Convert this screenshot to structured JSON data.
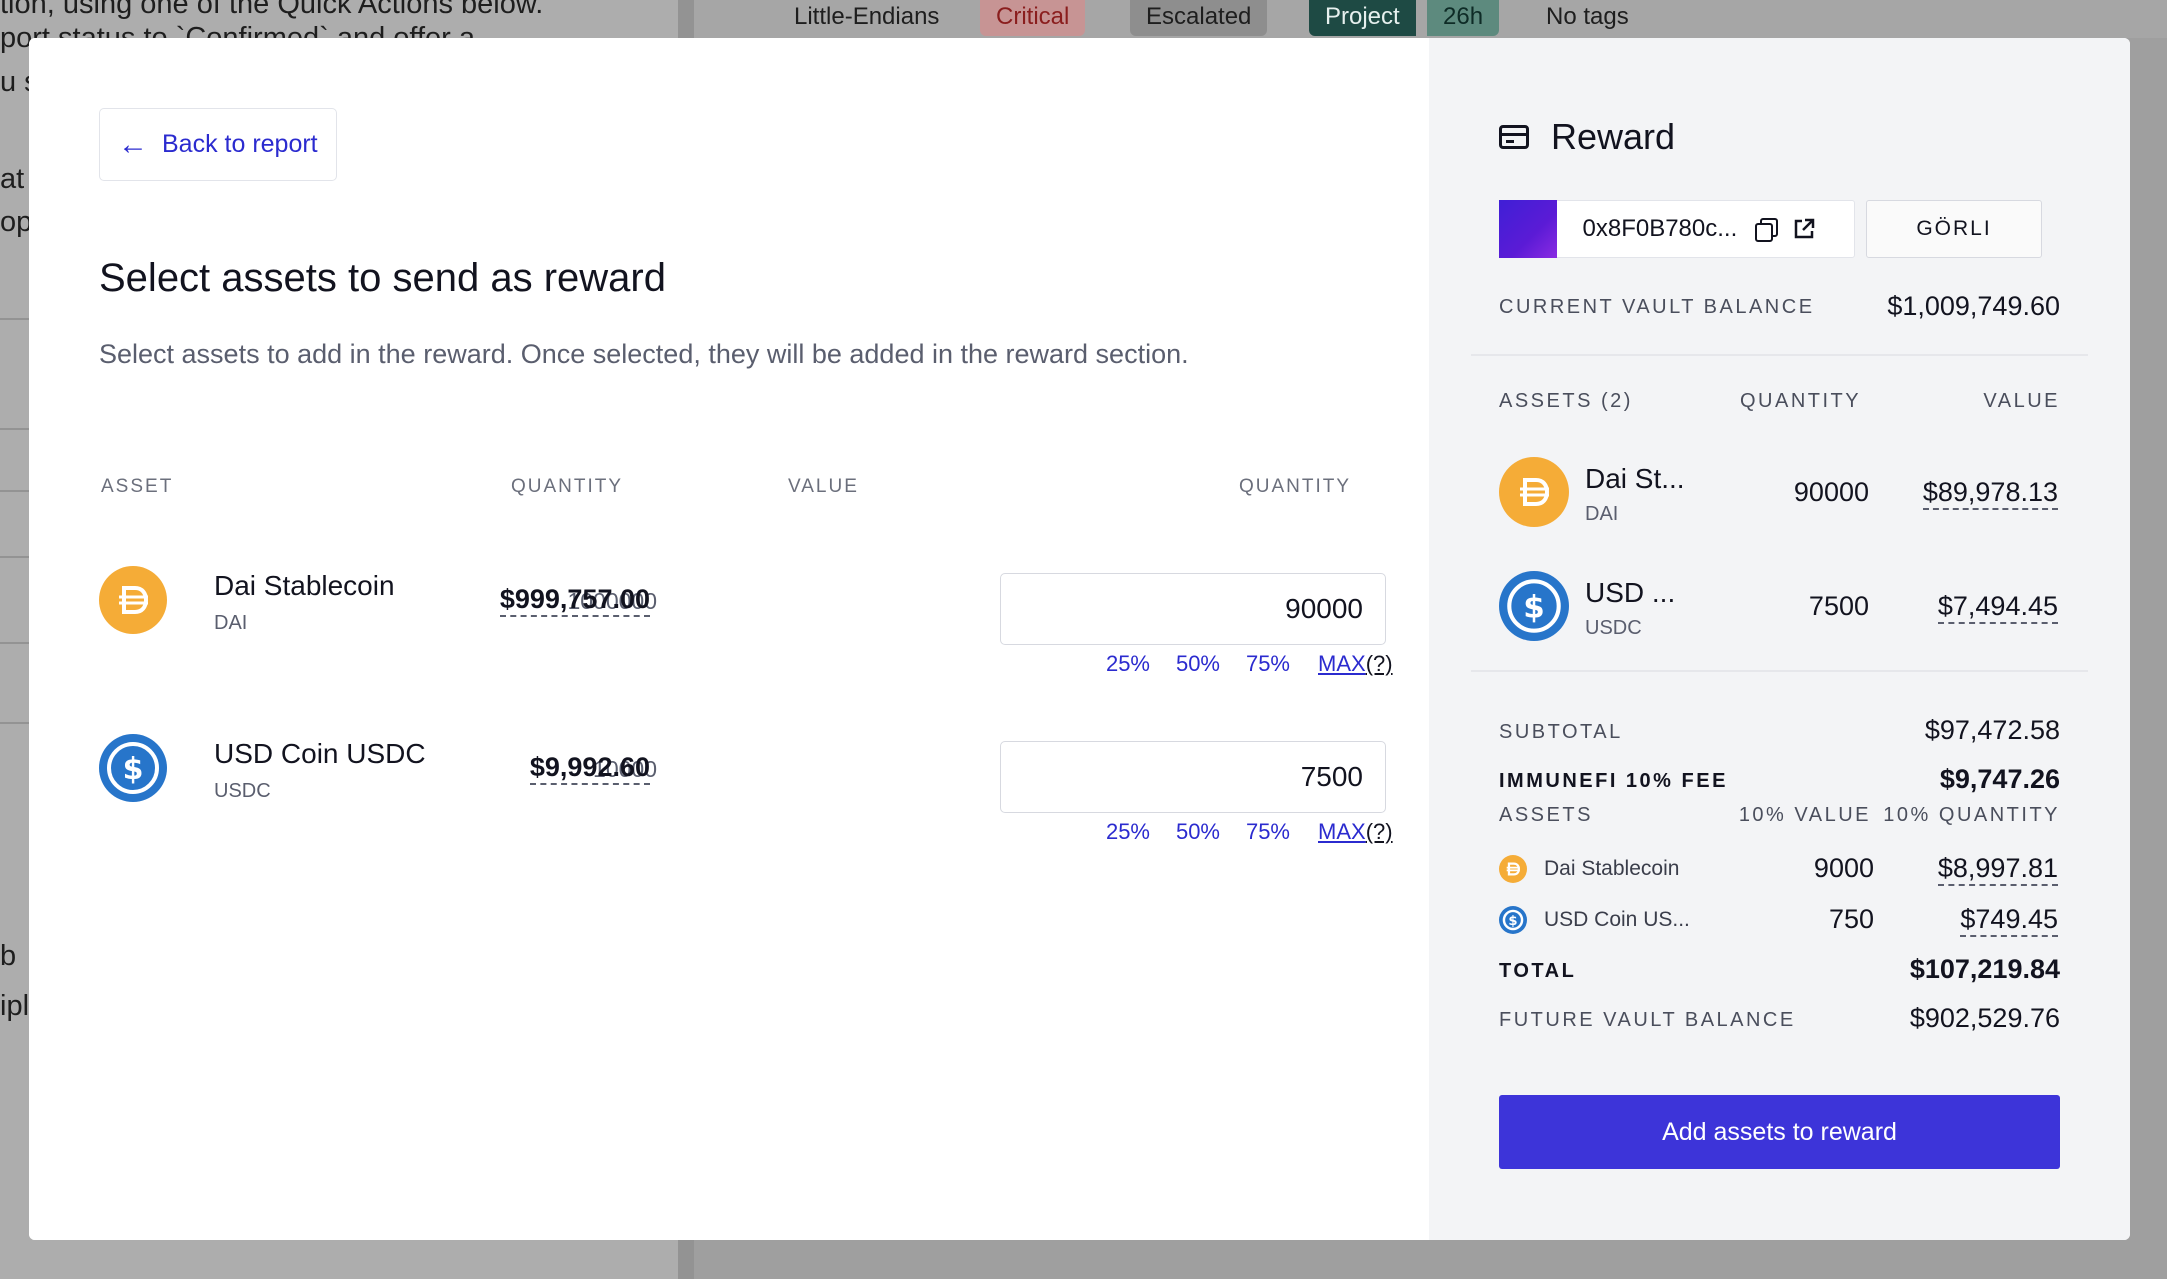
{
  "background": {
    "left_text_lines": [
      "tion, using one of the Quick Actions below.",
      "port status to `Confirmed` and offer a",
      "u s",
      "",
      "at",
      "op",
      "b",
      "ipl"
    ],
    "tags": {
      "project_name": "Little-Endians",
      "severity": "Critical",
      "status": "Escalated",
      "project_label": "Project",
      "age": "26h",
      "tags_text": "No tags"
    }
  },
  "modal": {
    "back_label": "Back to report",
    "title": "Select assets to send as reward",
    "subtitle": "Select assets to add in the reward. Once selected, they will be added in the reward section.",
    "table_headers": {
      "asset": "ASSET",
      "quantity": "QUANTITY",
      "value": "VALUE",
      "input_quantity": "QUANTITY"
    },
    "assets": [
      {
        "name": "Dai Stablecoin",
        "symbol": "DAI",
        "quantity": "1000000",
        "value": "$999,757.00",
        "input_value": "90000",
        "icon": "dai-icon"
      },
      {
        "name": "USD Coin USDC",
        "symbol": "USDC",
        "quantity": "10000",
        "value": "$9,992.60",
        "input_value": "7500",
        "icon": "usdc-icon"
      }
    ],
    "percent_options": [
      "25%",
      "50%",
      "75%"
    ],
    "max_label": "MAX",
    "max_help": "(?)"
  },
  "reward": {
    "heading": "Reward",
    "vault_address": "0x8F0B780c...",
    "network": "GÖRLI",
    "current_vault_balance_label": "CURRENT VAULT BALANCE",
    "current_vault_balance": "$1,009,749.60",
    "assets_header": {
      "assets": "ASSETS (2)",
      "quantity": "QUANTITY",
      "value": "VALUE"
    },
    "assets": [
      {
        "name": "Dai St...",
        "symbol": "DAI",
        "quantity": "90000",
        "value": "$89,978.13"
      },
      {
        "name": "USD ...",
        "symbol": "USDC",
        "quantity": "7500",
        "value": "$7,494.45"
      }
    ],
    "subtotal_label": "SUBTOTAL",
    "subtotal": "$97,472.58",
    "fee_label": "IMMUNEFI 10% FEE",
    "fee": "$9,747.26",
    "fee_header": {
      "assets": "ASSETS",
      "value": "10% VALUE",
      "quantity": "10% QUANTITY"
    },
    "fee_assets": [
      {
        "name": "Dai Stablecoin",
        "value": "9000",
        "quantity": "$8,997.81"
      },
      {
        "name": "USD Coin US...",
        "value": "750",
        "quantity": "$749.45"
      }
    ],
    "total_label": "TOTAL",
    "total": "$107,219.84",
    "future_vault_balance_label": "FUTURE VAULT BALANCE",
    "future_vault_balance": "$902,529.76",
    "cta_label": "Add assets to reward"
  },
  "colors": {
    "accent": "#3d34d9",
    "link": "#2b2bcf",
    "dai": "#f5ac37",
    "usdc": "#2775ca"
  }
}
